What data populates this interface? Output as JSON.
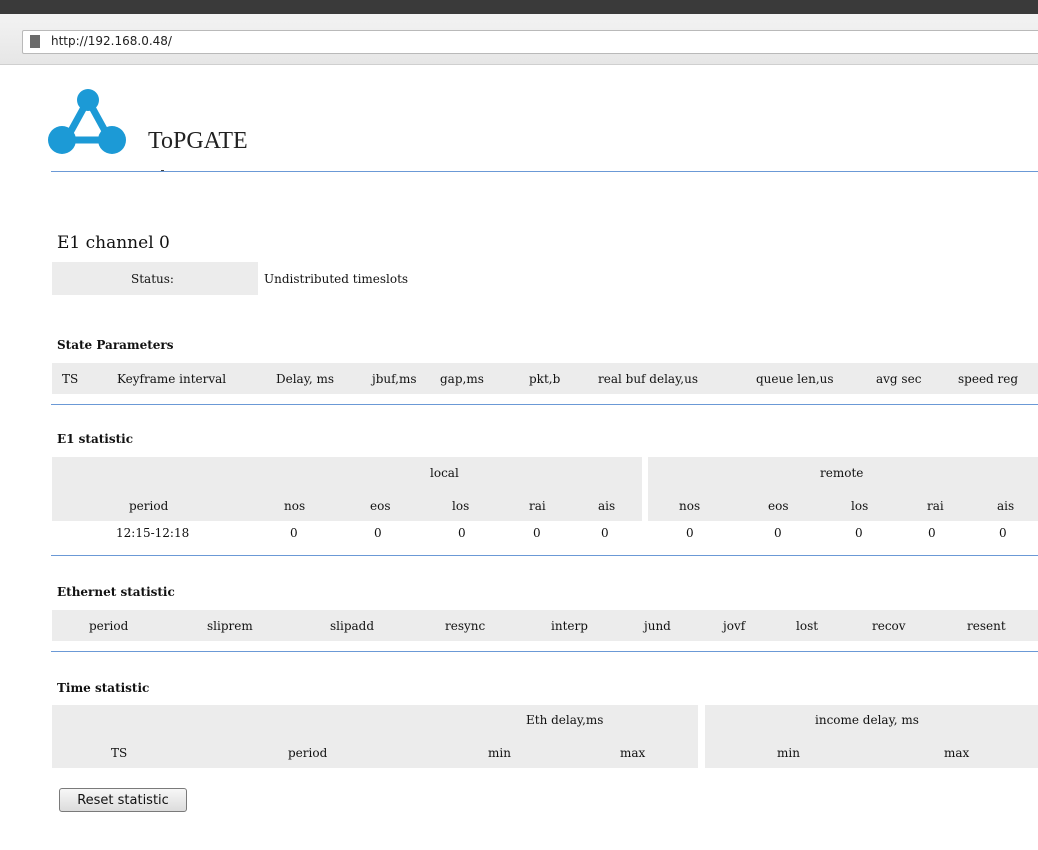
{
  "browser": {
    "url": "http://192.168.0.48/"
  },
  "header": {
    "brand": "ToPGATE"
  },
  "channel": {
    "title": "E1 channel 0",
    "status_label": "Status:",
    "status_value": "Undistributed timeslots"
  },
  "state_parameters": {
    "title": "State Parameters",
    "columns": [
      "TS",
      "Keyframe interval",
      "Delay, ms",
      "jbuf,ms",
      "gap,ms",
      "pkt,b",
      "real buf delay,us",
      "queue len,us",
      "avg sec",
      "speed reg"
    ]
  },
  "e1_statistic": {
    "title": "E1 statistic",
    "group_local": "local",
    "group_remote": "remote",
    "columns": [
      "period",
      "nos",
      "eos",
      "los",
      "rai",
      "ais",
      "nos",
      "eos",
      "los",
      "rai",
      "ais"
    ],
    "rows": [
      [
        "12:15-12:18",
        "0",
        "0",
        "0",
        "0",
        "0",
        "0",
        "0",
        "0",
        "0",
        "0"
      ]
    ]
  },
  "ethernet_statistic": {
    "title": "Ethernet statistic",
    "columns": [
      "period",
      "sliprem",
      "slipadd",
      "resync",
      "interp",
      "jund",
      "jovf",
      "lost",
      "recov",
      "resent"
    ]
  },
  "time_statistic": {
    "title": "Time statistic",
    "group_eth": "Eth delay,ms",
    "group_income": "income delay, ms",
    "columns": [
      "TS",
      "period",
      "min",
      "max",
      "min",
      "max"
    ]
  },
  "actions": {
    "reset_label": "Reset statistic"
  },
  "colors": {
    "accent_line": "#6b99d6",
    "logo_blue": "#1c9ad6",
    "header_bg": "#ececec"
  }
}
